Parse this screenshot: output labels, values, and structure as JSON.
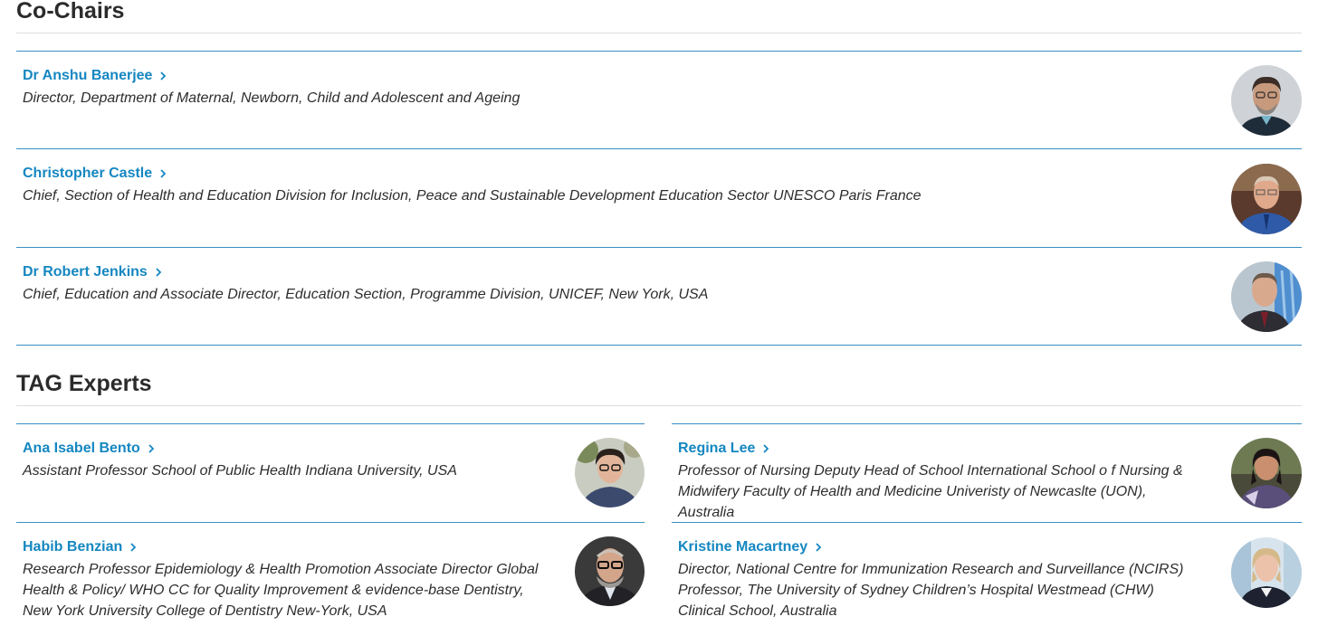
{
  "co_chairs": {
    "title": "Co-Chairs",
    "members": [
      {
        "name": "Dr Anshu Banerjee",
        "role": "Director, Department of Maternal, Newborn, Child and Adolescent and Ageing"
      },
      {
        "name": "Christopher Castle",
        "role": "Chief, Section of Health and Education Division for Inclusion, Peace and Sustainable Development Education Sector UNESCO Paris France"
      },
      {
        "name": "Dr Robert Jenkins",
        "role": "Chief, Education and Associate Director, Education Section, Programme Division, UNICEF, New York, USA"
      }
    ]
  },
  "tag_experts": {
    "title": "TAG Experts",
    "members": [
      {
        "name": "Ana Isabel Bento",
        "role": "Assistant Professor School of Public Health Indiana University, USA"
      },
      {
        "name": "Regina Lee",
        "role": "Professor of Nursing Deputy Head of School International School o f Nursing & Midwifery Faculty of Health and Medicine Univeristy of Newcaslte (UON), Australia"
      },
      {
        "name": "Habib Benzian",
        "role": "Research Professor Epidemiology & Health Promotion Associate Director Global Health & Policy/ WHO CC for Quality Improvement & evidence-base Dentistry, New York University College of Dentistry New-York, USA"
      },
      {
        "name": "Kristine Macartney",
        "role": "Director, National Centre for Immunization Research and Surveillance (NCIRS) Professor, The University of Sydney Children’s Hospital Westmead (CHW) Clinical School, Australia"
      }
    ]
  },
  "icons": {
    "link_chevron": "chevron-right-icon",
    "portrait": "person-photo"
  },
  "colors": {
    "accent": "#1587c1",
    "divider": "#3a8fc4",
    "heading": "#2b2b2b"
  }
}
